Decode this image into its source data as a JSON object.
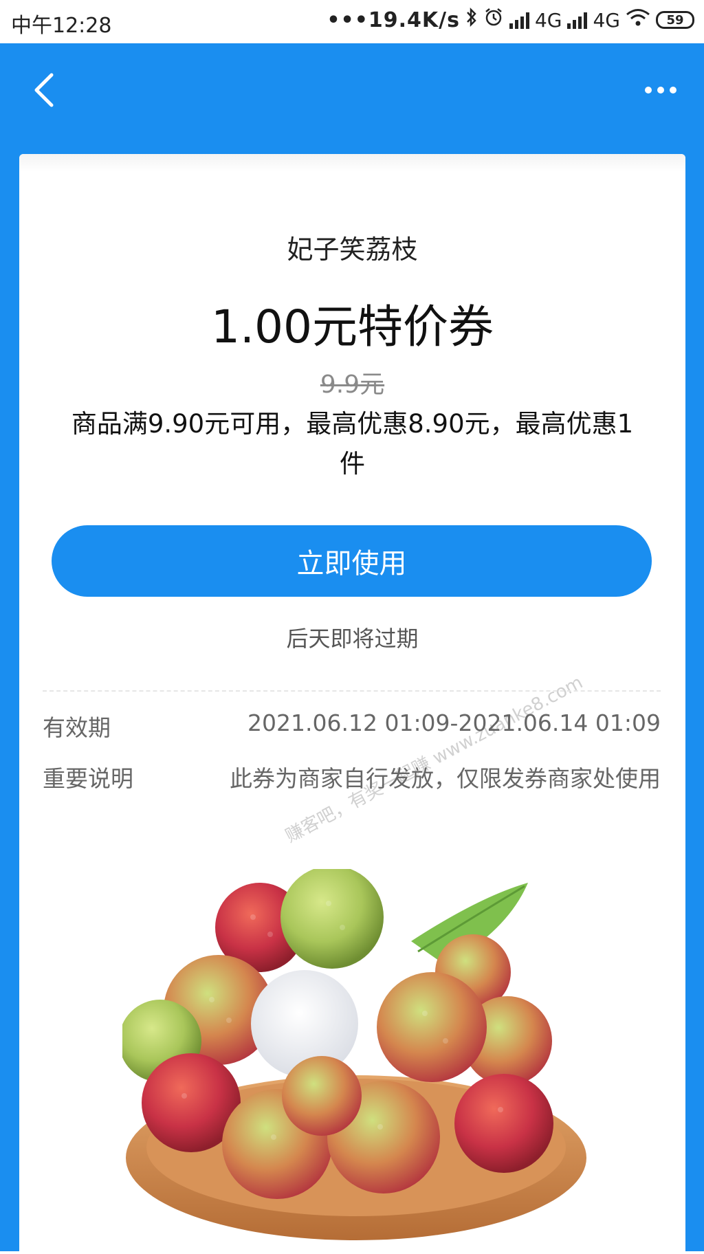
{
  "status_bar": {
    "time": "中午12:28",
    "net_speed": "•••19.4K/s",
    "net1": "4G",
    "net2": "4G",
    "battery": "59"
  },
  "header": {
    "back_icon": "chevron-left-icon",
    "more_icon": "more-dots-icon",
    "bg_color": "#1a8ef0"
  },
  "coupon": {
    "shop_name": "妃子笑荔枝",
    "title": "1.00元特价券",
    "original_price": "9.9元",
    "rule_line1": "商品满9.90元可用，最高优惠8.90元，最高优惠1",
    "rule_line2": "件",
    "use_button": "立即使用",
    "expire_note": "后天即将过期"
  },
  "details": {
    "validity_label": "有效期",
    "validity_value": "2021.06.12 01:09-2021.06.14 01:09",
    "note_label": "重要说明",
    "note_value": "此券为商家自行发放，仅限发券商家处使用"
  },
  "watermark": "赚客吧，有奖一起赚 www.zuanke8.com",
  "product_image": "lychee-plate-image"
}
